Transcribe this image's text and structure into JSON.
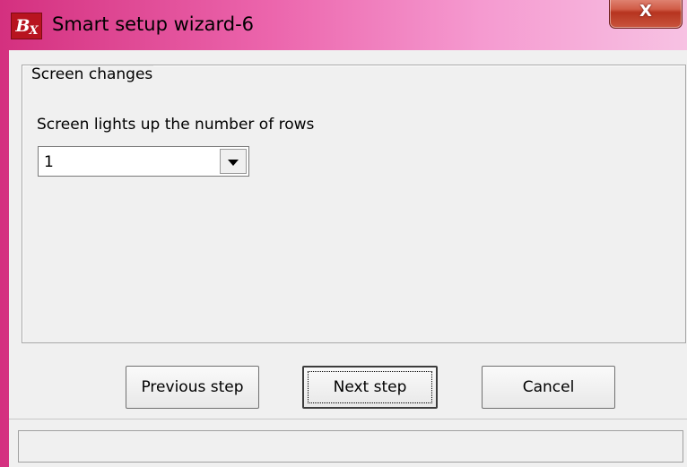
{
  "window": {
    "app_icon_text": "B",
    "app_icon_sub": "X",
    "title": "Smart setup wizard-6",
    "close_glyph": "X"
  },
  "group": {
    "legend": "Screen changes",
    "field_label": "Screen lights up the number of rows",
    "rows_select": {
      "value": "1"
    }
  },
  "buttons": {
    "previous": "Previous step",
    "next": "Next step",
    "cancel": "Cancel"
  },
  "statusbar": {
    "text": ""
  },
  "colors": {
    "titlebar_gradient": [
      "#d4307f",
      "#ec66ad",
      "#f59ad0",
      "#f7c2e3"
    ],
    "close_button": "#c9553e",
    "app_icon": "#b8141f",
    "dialog_bg": "#f0f0f0"
  },
  "icons": {
    "app": "bx-app-icon",
    "close": "close-icon",
    "dropdown": "chevron-down-icon"
  }
}
